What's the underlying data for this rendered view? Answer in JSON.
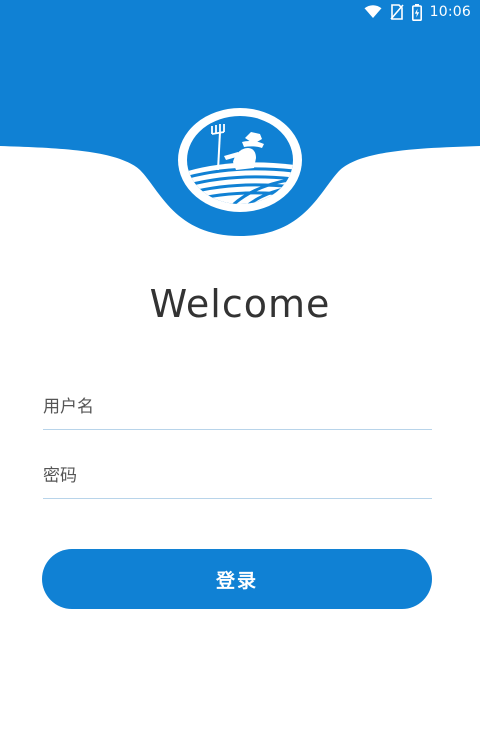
{
  "status_bar": {
    "time": "10:06",
    "icons": [
      "wifi-icon",
      "no-sim-icon",
      "battery-charging-icon"
    ]
  },
  "colors": {
    "brand_blue": "#1081d4",
    "background": "#ffffff",
    "divider": "#b8d4ea",
    "title_text": "#333333"
  },
  "logo": {
    "icon": "farmer-logo-icon"
  },
  "welcome": {
    "title": "Welcome"
  },
  "form": {
    "username_placeholder": "用户名",
    "password_placeholder": "密码",
    "login_label": "登录"
  }
}
